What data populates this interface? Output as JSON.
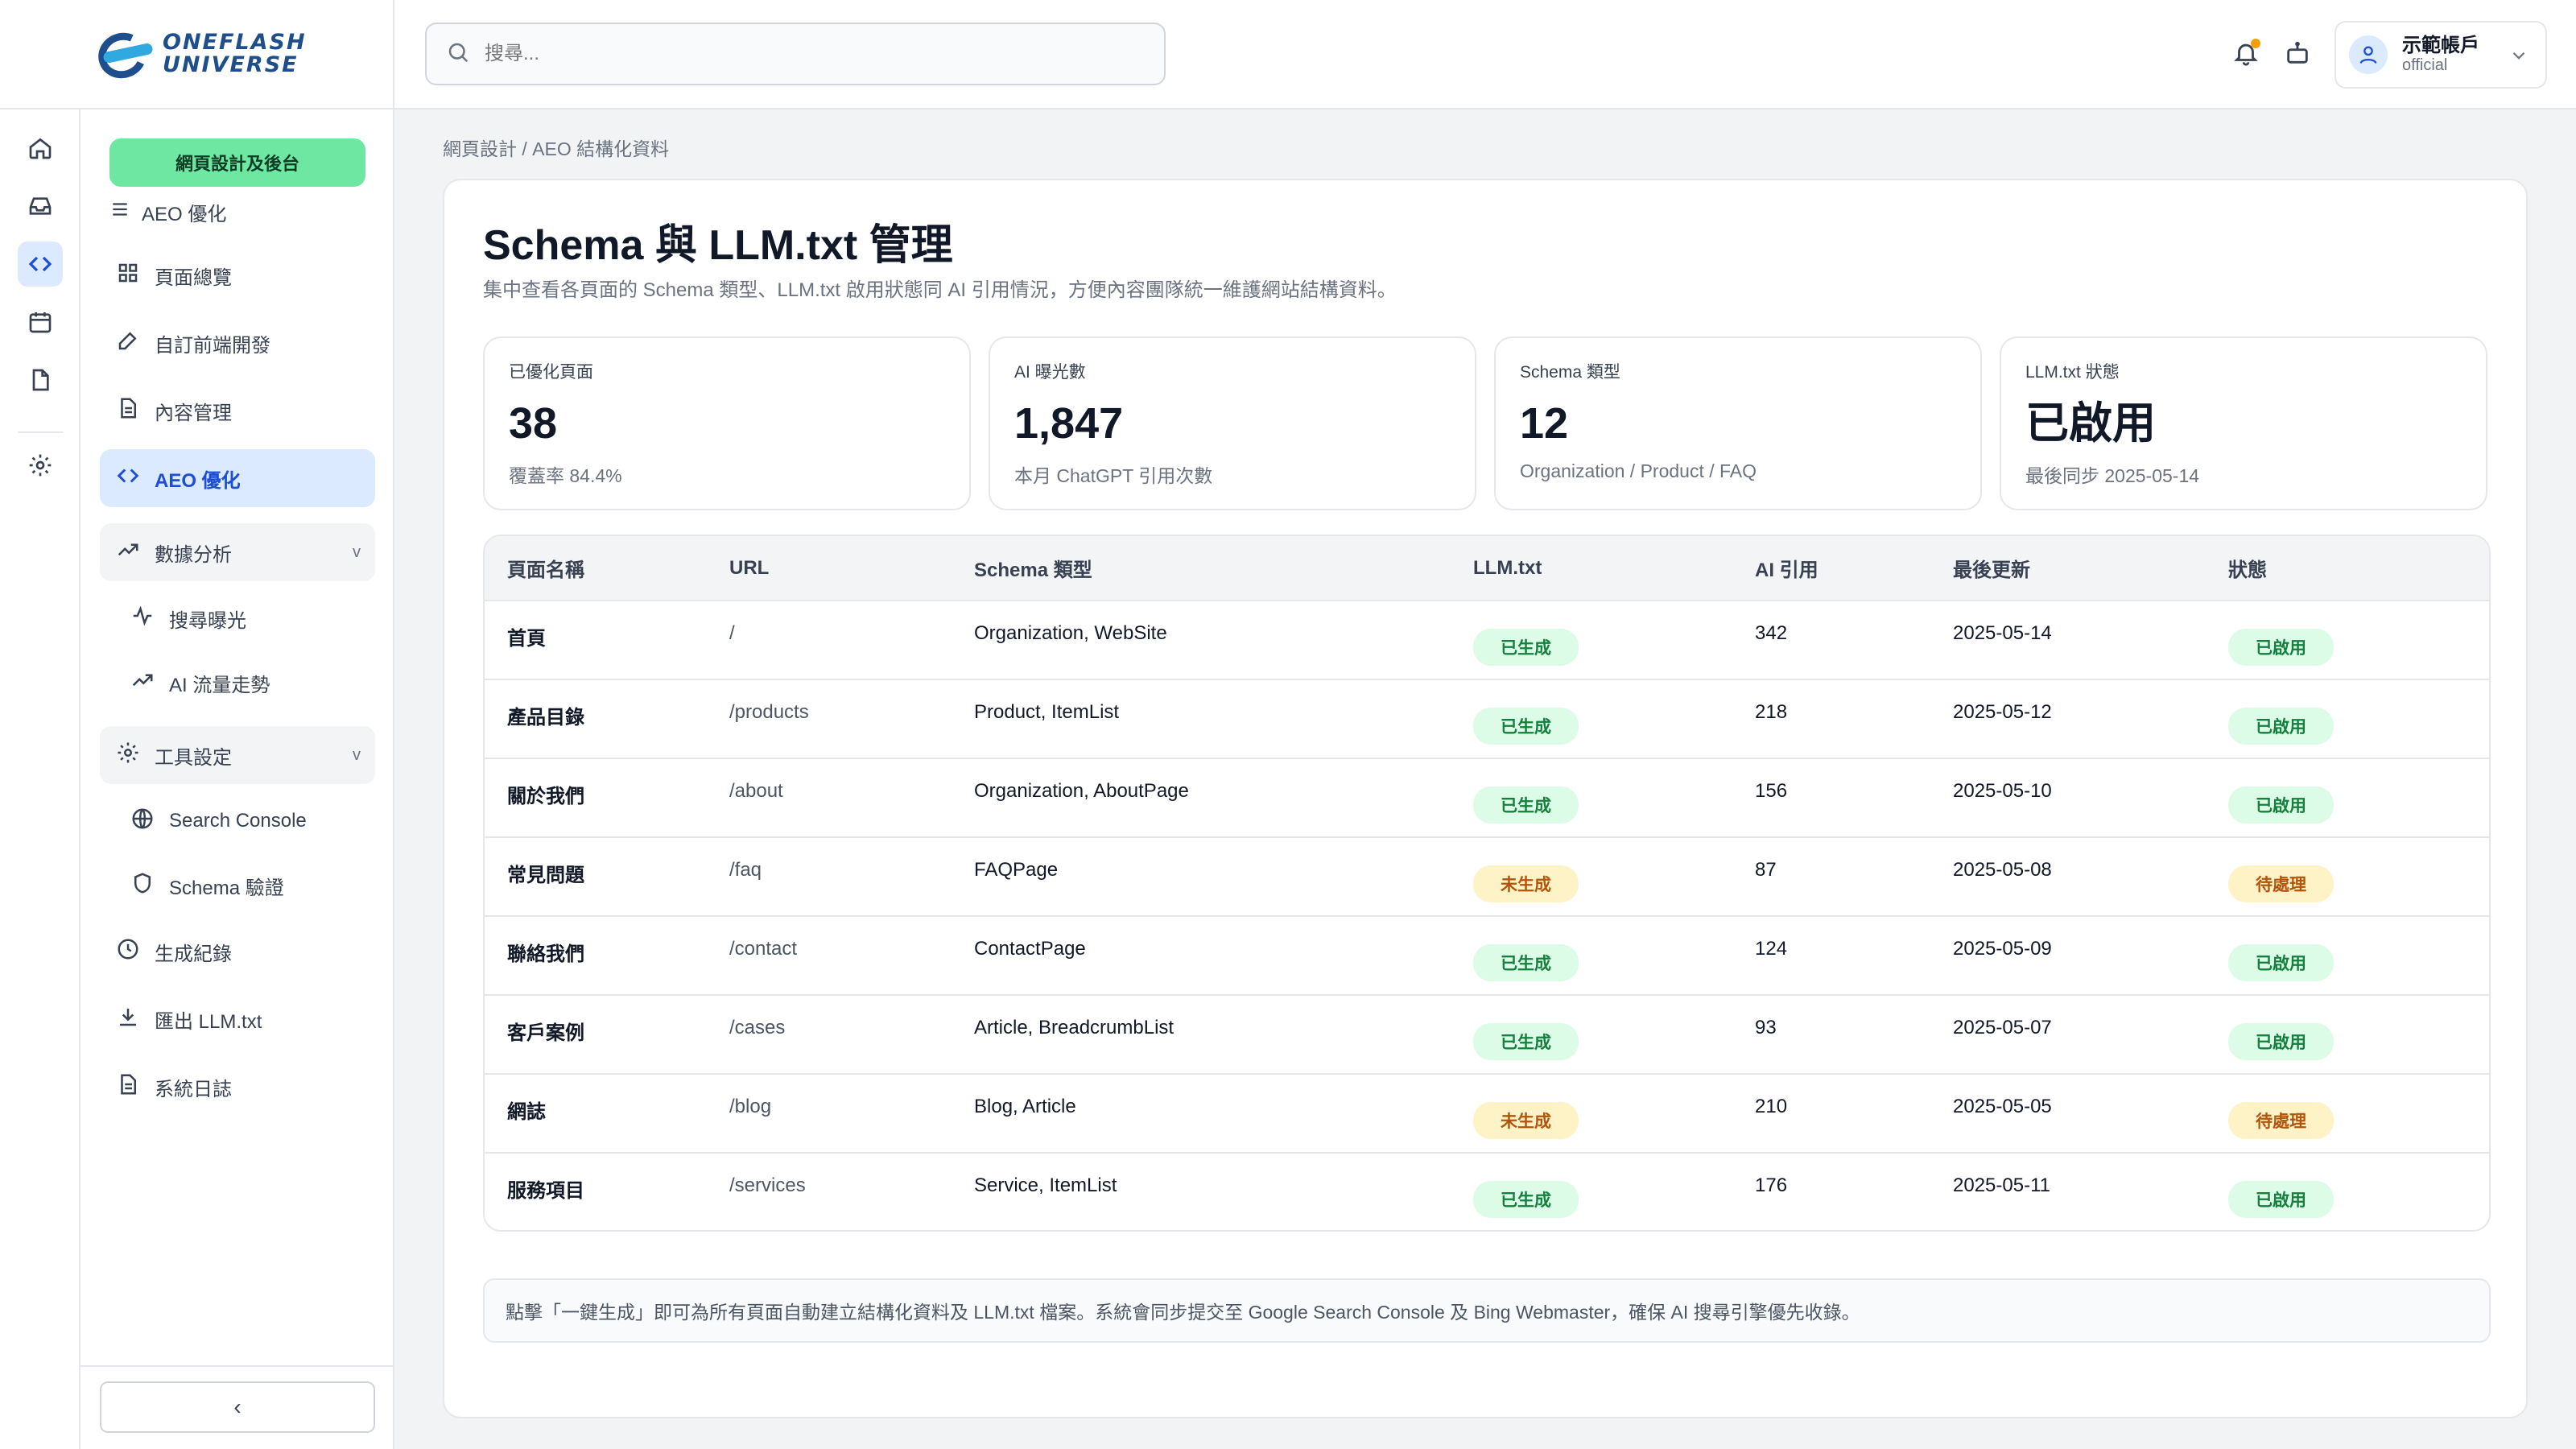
{
  "brand": {
    "line1": "ONEFLASH",
    "line2": "UNIVERSE"
  },
  "search": {
    "placeholder": "搜尋..."
  },
  "account": {
    "name": "示範帳戶",
    "role": "official"
  },
  "rail_icons": [
    "home-icon",
    "inbox-icon",
    "code-icon",
    "calendar-icon",
    "file-icon",
    "gear-icon"
  ],
  "sidebar": {
    "primary_button": "網頁設計及後台",
    "section_title": "AEO 優化",
    "items": [
      {
        "label": "頁面總覽",
        "icon": "grid-icon"
      },
      {
        "label": "自訂前端開發",
        "icon": "pen-icon"
      },
      {
        "label": "內容管理",
        "icon": "document-icon"
      },
      {
        "label": "AEO 優化",
        "icon": "code-icon",
        "active": true
      }
    ],
    "analytics_group": {
      "label": "數據分析",
      "chevron": "v",
      "children": [
        "搜尋曝光",
        "AI 流量走勢"
      ]
    },
    "tools_group": {
      "label": "工具設定",
      "chevron": "v",
      "children": [
        "Search Console",
        "Schema 驗證"
      ]
    },
    "bottom_items": [
      "生成紀錄",
      "匯出 LLM.txt",
      "系統日誌"
    ],
    "collapse_label": "‹"
  },
  "breadcrumb": "網頁設計 / AEO 結構化資料",
  "page": {
    "title": "Schema 與 LLM.txt 管理",
    "subtitle": "集中查看各頁面的 Schema 類型、LLM.txt 啟用狀態同 AI 引用情況，方便內容團隊統一維護網站結構資料。"
  },
  "stats": [
    {
      "label": "已優化頁面",
      "value": "38",
      "note": "覆蓋率 84.4%"
    },
    {
      "label": "AI 曝光數",
      "value": "1,847",
      "note": "本月 ChatGPT 引用次數"
    },
    {
      "label": "Schema 類型",
      "value": "12",
      "note": "Organization / Product / FAQ"
    },
    {
      "label": "LLM.txt 狀態",
      "value": "已啟用",
      "note": "最後同步 2025-05-14"
    }
  ],
  "table": {
    "headers": [
      "頁面名稱",
      "URL",
      "Schema 類型",
      "LLM.txt",
      "AI 引用",
      "最後更新",
      "狀態"
    ],
    "rows": [
      {
        "name": "首頁",
        "url": "/",
        "schema": "Organization, WebSite",
        "llm": "已生成",
        "llm_ok": true,
        "refs": "342",
        "updated": "2025-05-14",
        "status": "已啟用",
        "status_ok": true
      },
      {
        "name": "產品目錄",
        "url": "/products",
        "schema": "Product, ItemList",
        "llm": "已生成",
        "llm_ok": true,
        "refs": "218",
        "updated": "2025-05-12",
        "status": "已啟用",
        "status_ok": true
      },
      {
        "name": "關於我們",
        "url": "/about",
        "schema": "Organization, AboutPage",
        "llm": "已生成",
        "llm_ok": true,
        "refs": "156",
        "updated": "2025-05-10",
        "status": "已啟用",
        "status_ok": true
      },
      {
        "name": "常見問題",
        "url": "/faq",
        "schema": "FAQPage",
        "llm": "未生成",
        "llm_ok": false,
        "refs": "87",
        "updated": "2025-05-08",
        "status": "待處理",
        "status_ok": false
      },
      {
        "name": "聯絡我們",
        "url": "/contact",
        "schema": "ContactPage",
        "llm": "已生成",
        "llm_ok": true,
        "refs": "124",
        "updated": "2025-05-09",
        "status": "已啟用",
        "status_ok": true
      },
      {
        "name": "客戶案例",
        "url": "/cases",
        "schema": "Article, BreadcrumbList",
        "llm": "已生成",
        "llm_ok": true,
        "refs": "93",
        "updated": "2025-05-07",
        "status": "已啟用",
        "status_ok": true
      },
      {
        "name": "網誌",
        "url": "/blog",
        "schema": "Blog, Article",
        "llm": "未生成",
        "llm_ok": false,
        "refs": "210",
        "updated": "2025-05-05",
        "status": "待處理",
        "status_ok": false
      },
      {
        "name": "服務項目",
        "url": "/services",
        "schema": "Service, ItemList",
        "llm": "已生成",
        "llm_ok": true,
        "refs": "176",
        "updated": "2025-05-11",
        "status": "已啟用",
        "status_ok": true
      }
    ]
  },
  "info": "點擊「一鍵生成」即可為所有頁面自動建立結構化資料及 LLM.txt 檔案。系統會同步提交至 Google Search Console 及 Bing Webmaster，確保 AI 搜尋引擎優先收錄。",
  "colors": {
    "accent": "#1d4ed8",
    "primary_button": "#6ee7a3",
    "ok": "#15803d",
    "warn": "#b45309"
  }
}
